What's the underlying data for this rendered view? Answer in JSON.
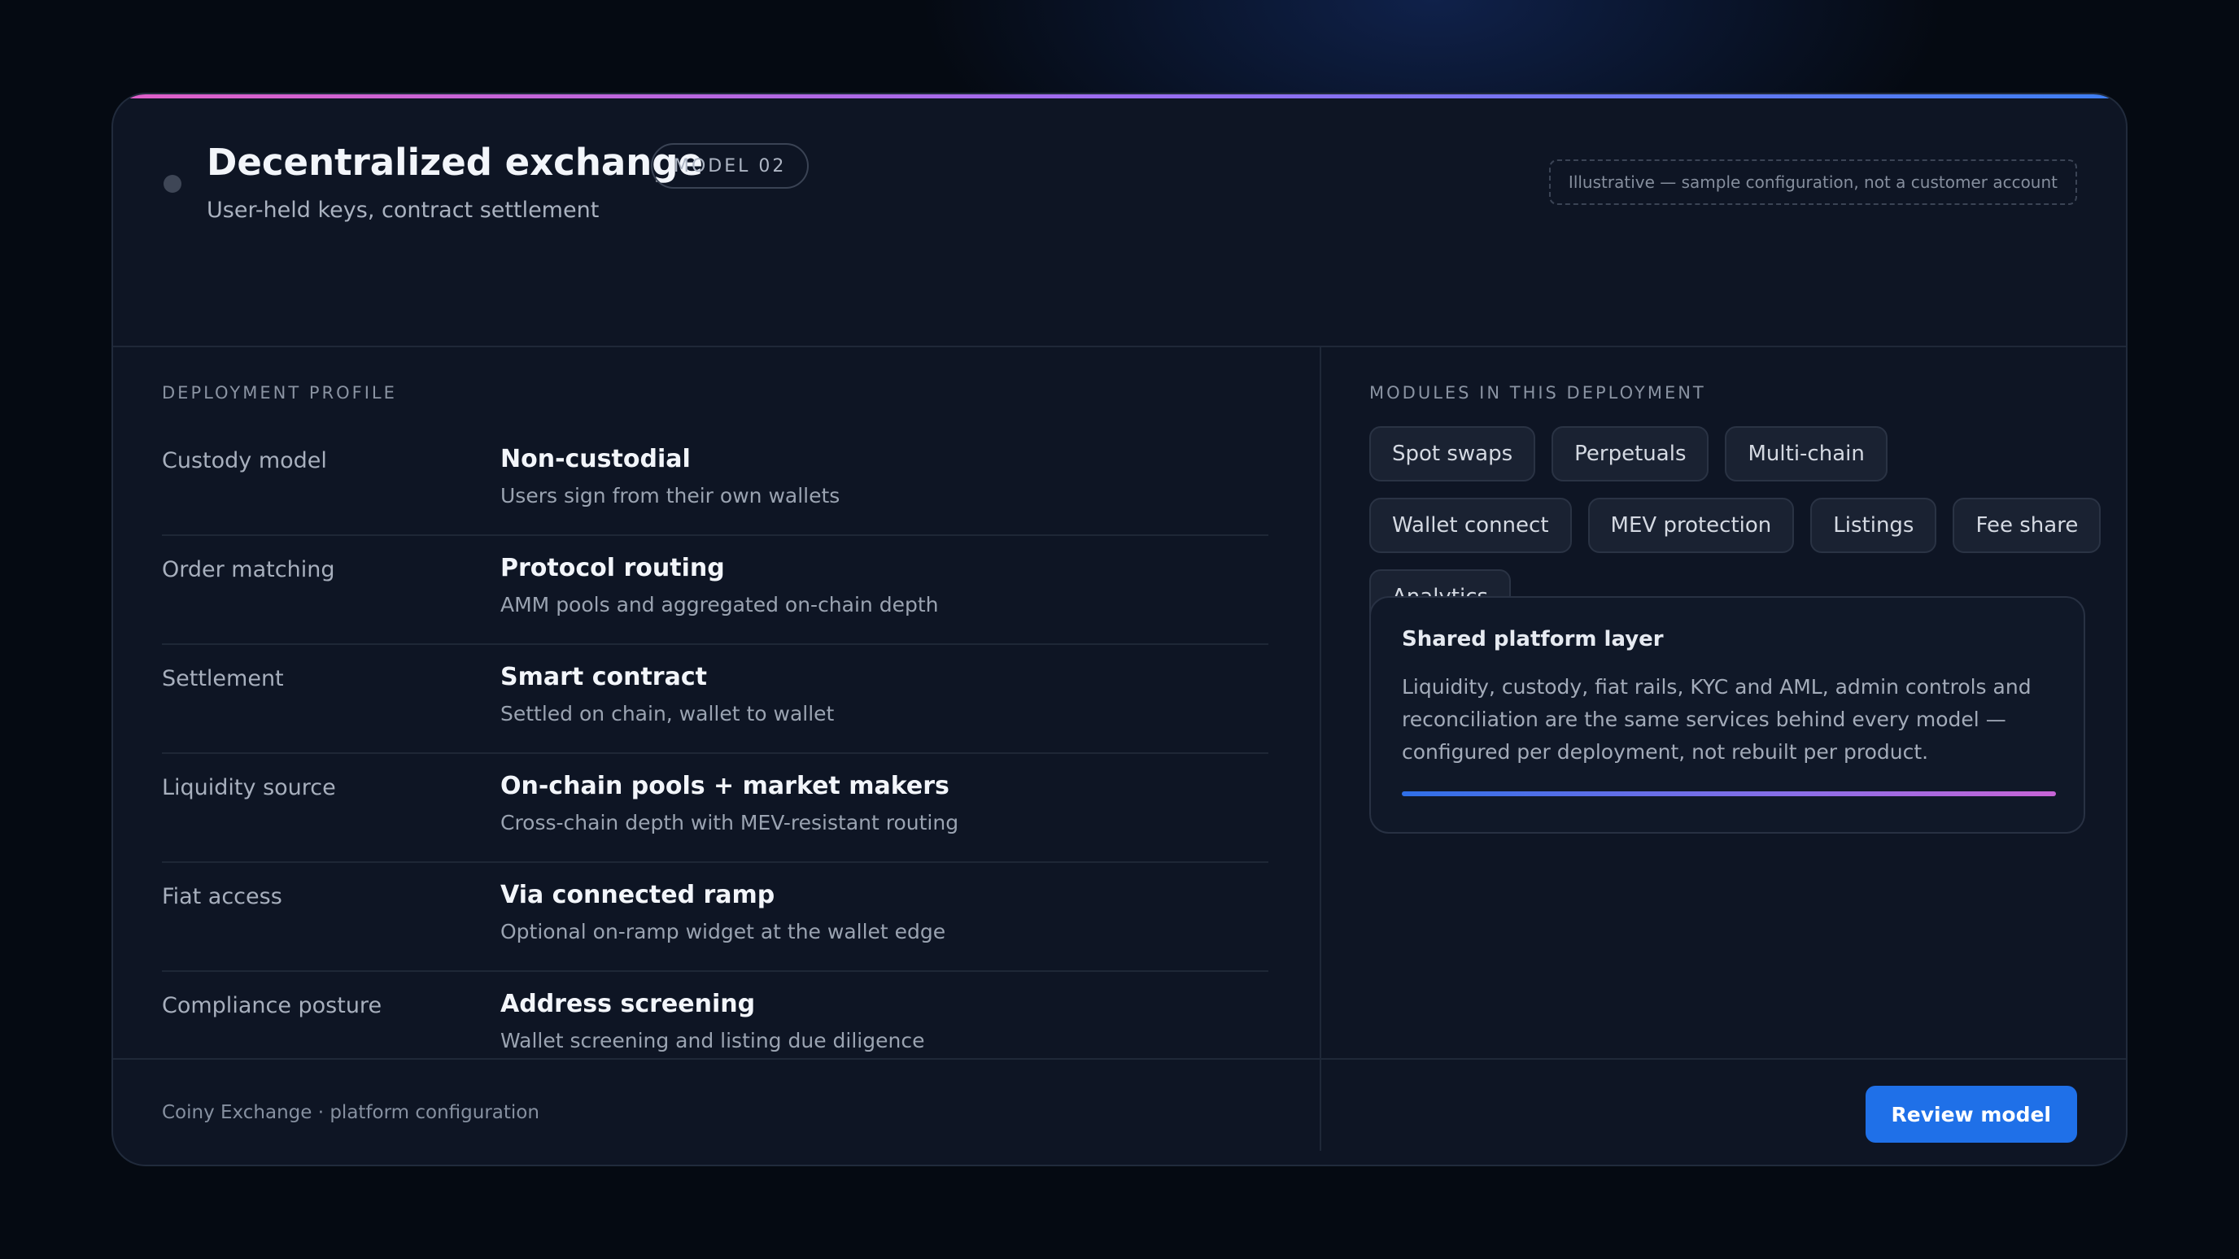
{
  "header": {
    "title": "Decentralized exchange",
    "badge": "MODEL 02",
    "subtitle": "User-held keys, contract settlement",
    "disclaimer": "Illustrative — sample configuration, not a customer account"
  },
  "profile": {
    "section_label": "DEPLOYMENT PROFILE",
    "rows": [
      {
        "label": "Custody model",
        "value": "Non-custodial",
        "desc": "Users sign from their own wallets"
      },
      {
        "label": "Order matching",
        "value": "Protocol routing",
        "desc": "AMM pools and aggregated on-chain depth"
      },
      {
        "label": "Settlement",
        "value": "Smart contract",
        "desc": "Settled on chain, wallet to wallet"
      },
      {
        "label": "Liquidity source",
        "value": "On-chain pools + market makers",
        "desc": "Cross-chain depth with MEV-resistant routing"
      },
      {
        "label": "Fiat access",
        "value": "Via connected ramp",
        "desc": "Optional on-ramp widget at the wallet edge"
      },
      {
        "label": "Compliance posture",
        "value": "Address screening",
        "desc": "Wallet screening and listing due diligence"
      }
    ]
  },
  "modules": {
    "section_label": "MODULES IN THIS DEPLOYMENT",
    "chips": [
      "Spot swaps",
      "Perpetuals",
      "Multi-chain",
      "Wallet connect",
      "MEV protection",
      "Listings",
      "Fee share",
      "Analytics"
    ]
  },
  "shared": {
    "title": "Shared platform layer",
    "text": "Liquidity, custody, fiat rails, KYC and AML, admin controls and reconciliation are the same services behind every model — configured per deployment, not rebuilt per product."
  },
  "footer": {
    "text": "Coiny Exchange · platform configuration",
    "button_label": "Review model"
  },
  "colors": {
    "accent": "#1f70e8",
    "background": "#050a12",
    "card": "#0e1524"
  }
}
